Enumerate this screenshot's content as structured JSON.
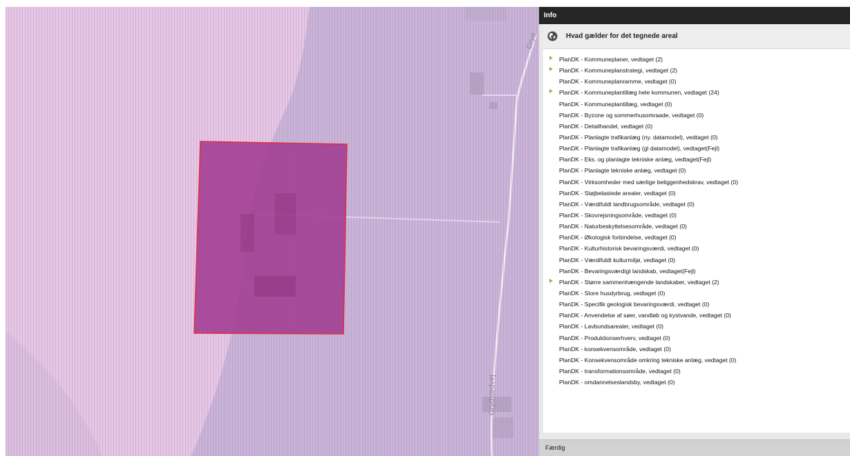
{
  "map": {
    "road_label": "Grydstedvej",
    "road_label_top": "Gryd",
    "colors": {
      "left_zone": "#e8c7e5",
      "right_zone": "#c9b4d7",
      "hatch": "#a98bbd",
      "selection_fill": "#a0378f",
      "selection_stroke": "#e32d3c"
    }
  },
  "panel": {
    "header_title": "Info",
    "title_icon": "globe-icon",
    "title": "Hvad gælder for det tegnede areal",
    "status": "Færdig",
    "toggle_color": "#7cc243",
    "layers": [
      {
        "label": "PlanDK - Kommuneplaner, vedtaget (2)",
        "expandable": true
      },
      {
        "label": "PlanDK - Kommuneplanstrategi, vedtaget (2)",
        "expandable": true
      },
      {
        "label": "PlanDK - Kommuneplanramme, vedtaget (0)",
        "expandable": false
      },
      {
        "label": "PlanDK - Kommuneplantillæg hele kommunen, vedtaget (24)",
        "expandable": true
      },
      {
        "label": "PlanDK - Kommuneplantillæg, vedtaget (0)",
        "expandable": false
      },
      {
        "label": "PlanDK - Byzone og sommerhusomraade, vedtaget (0)",
        "expandable": false
      },
      {
        "label": "PlanDK - Detailhandel, vedtaget (0)",
        "expandable": false
      },
      {
        "label": "PlanDK - Planlagte trafikanlæg (ny. datamodel), vedtaget (0)",
        "expandable": false
      },
      {
        "label": "PlanDK - Planlagte trafikanlæg (gl datamodel), vedtaget(Fejl)",
        "expandable": false
      },
      {
        "label": "PlanDK - Eks. og planlagte tekniske anlæg, vedtaget(Fejl)",
        "expandable": false
      },
      {
        "label": "PlanDK - Planlagte tekniske anlæg, vedtaget (0)",
        "expandable": false
      },
      {
        "label": "PlanDK - Virksomheder med særlige beliggenhedskrav, vedtaget (0)",
        "expandable": false
      },
      {
        "label": "PlanDK - Støjbelastede arealer, vedtaget (0)",
        "expandable": false
      },
      {
        "label": "PlanDK - Værdifuldt landbrugsområde, vedtaget (0)",
        "expandable": false
      },
      {
        "label": "PlanDK - Skovrejsningsområde, vedtaget (0)",
        "expandable": false
      },
      {
        "label": "PlanDK - Naturbeskyttelsesområde, vedtaget (0)",
        "expandable": false
      },
      {
        "label": "PlanDK - Økologisk forbindelse, vedtaget (0)",
        "expandable": false
      },
      {
        "label": "PlanDK - Kulturhistorisk bevaringsværdi, vedtaget (0)",
        "expandable": false
      },
      {
        "label": "PlanDK - Værdifuldt kulturmiljø, vedtaget (0)",
        "expandable": false
      },
      {
        "label": "PlanDK - Bevaringsværdigt landskab, vedtaget(Fejl)",
        "expandable": false
      },
      {
        "label": "PlanDK - Større sammenhængende landskaber, vedtaget (2)",
        "expandable": true
      },
      {
        "label": "PlanDK - Store husdyrbrug, vedtaget (0)",
        "expandable": false
      },
      {
        "label": "PlanDK - Specifik geologisk bevaringsværdi, vedtaget (0)",
        "expandable": false
      },
      {
        "label": "PlanDK - Anvendelse af søer, vandløb og kystvande, vedtaget (0)",
        "expandable": false
      },
      {
        "label": "PlanDK - Lavbundsarealer, vedtaget (0)",
        "expandable": false
      },
      {
        "label": "PlanDK - Produktionserhverv, vedtaget (0)",
        "expandable": false
      },
      {
        "label": "PlanDK - konsekvensområde, vedtaget (0)",
        "expandable": false
      },
      {
        "label": "PlanDK - Konsekvensområde omkring tekniske anlæg, vedtaget (0)",
        "expandable": false
      },
      {
        "label": "PlanDK - transformationsområde, vedtaget (0)",
        "expandable": false
      },
      {
        "label": "PlanDK - omdannelseslandsby, vedtaget (0)",
        "expandable": false
      }
    ]
  }
}
